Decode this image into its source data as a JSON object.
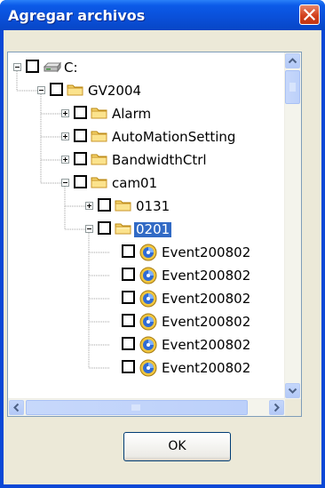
{
  "window": {
    "title": "Agregar archivos",
    "close_icon": "close-icon"
  },
  "tree": {
    "nodes": [
      {
        "label": "C:",
        "icon": "drive-icon",
        "expander": "minus",
        "selected": false,
        "checked": false
      },
      {
        "label": "GV2004",
        "icon": "folder-icon",
        "expander": "minus",
        "selected": false,
        "checked": false
      },
      {
        "label": "Alarm",
        "icon": "folder-icon",
        "expander": "plus",
        "selected": false,
        "checked": false
      },
      {
        "label": "AutoMationSetting",
        "icon": "folder-icon",
        "expander": "plus",
        "selected": false,
        "checked": false
      },
      {
        "label": "BandwidthCtrl",
        "icon": "folder-icon",
        "expander": "plus",
        "selected": false,
        "checked": false
      },
      {
        "label": "cam01",
        "icon": "folder-icon",
        "expander": "minus",
        "selected": false,
        "checked": false
      },
      {
        "label": "0131",
        "icon": "folder-icon",
        "expander": "plus",
        "selected": false,
        "checked": false
      },
      {
        "label": "0201",
        "icon": "folder-icon",
        "expander": "minus",
        "selected": true,
        "checked": false
      },
      {
        "label": "Event200802",
        "icon": "event-file-icon",
        "expander": "none",
        "selected": false,
        "checked": false
      },
      {
        "label": "Event200802",
        "icon": "event-file-icon",
        "expander": "none",
        "selected": false,
        "checked": false
      },
      {
        "label": "Event200802",
        "icon": "event-file-icon",
        "expander": "none",
        "selected": false,
        "checked": false
      },
      {
        "label": "Event200802",
        "icon": "event-file-icon",
        "expander": "none",
        "selected": false,
        "checked": false
      },
      {
        "label": "Event200802",
        "icon": "event-file-icon",
        "expander": "none",
        "selected": false,
        "checked": false
      },
      {
        "label": "Event200802",
        "icon": "event-file-icon",
        "expander": "none",
        "selected": false,
        "checked": false
      }
    ],
    "vertical_scroll_position": 0,
    "horizontal_scroll_position": 0
  },
  "buttons": {
    "ok_label": "OK"
  },
  "colors": {
    "title_bar": "#0a4fd8",
    "selection": "#316ac5",
    "dialog_face": "#ece9d8",
    "close_button": "#d3411e"
  }
}
